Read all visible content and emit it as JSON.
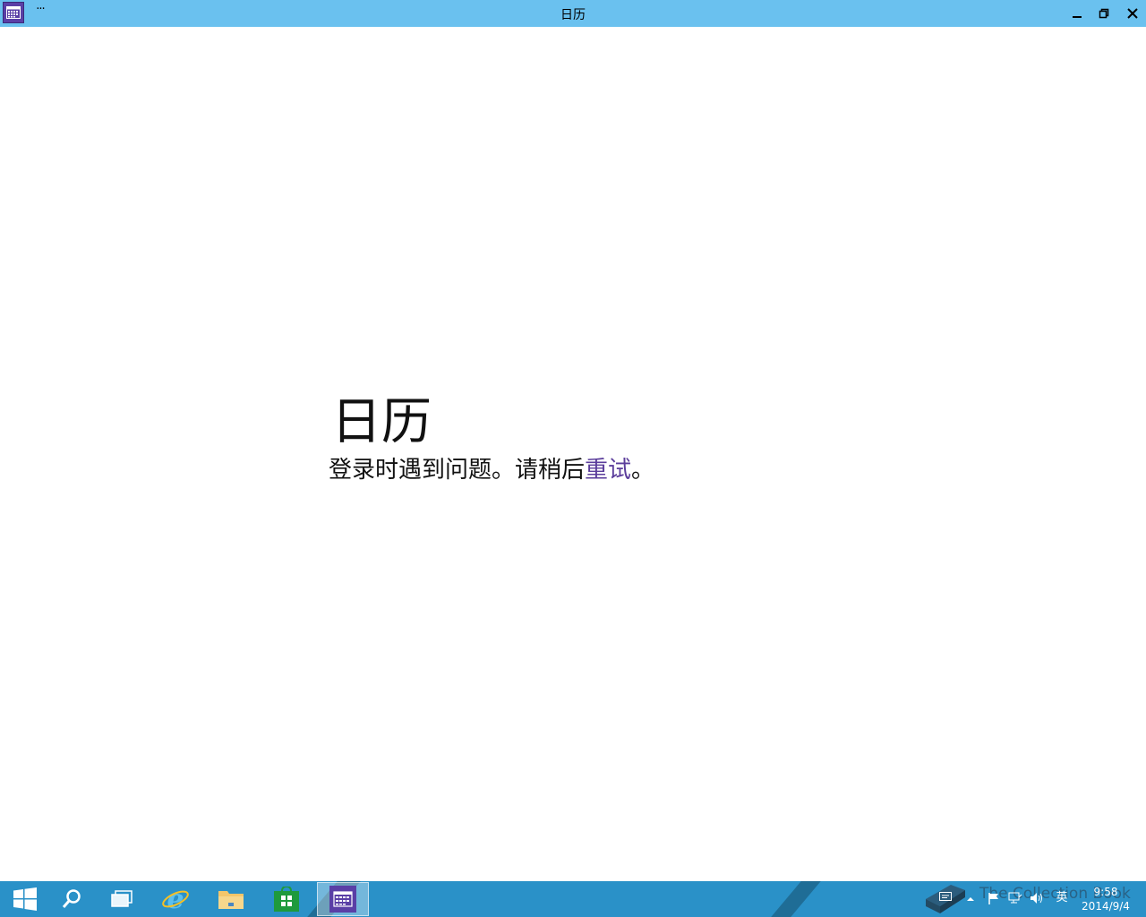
{
  "window": {
    "title": "日历",
    "more_label": "···"
  },
  "main": {
    "heading": "日历",
    "error_prefix": "登录时遇到问题。请稍后",
    "retry_link": "重试",
    "error_suffix": "。"
  },
  "taskbar": {
    "apps": [
      {
        "name": "start",
        "icon": "windows-logo-icon"
      },
      {
        "name": "search",
        "icon": "search-icon"
      },
      {
        "name": "task-view",
        "icon": "task-view-icon"
      },
      {
        "name": "internet-explorer",
        "icon": "ie-icon"
      },
      {
        "name": "file-explorer",
        "icon": "folder-icon"
      },
      {
        "name": "store",
        "icon": "store-icon"
      },
      {
        "name": "calendar",
        "icon": "calendar-icon",
        "active": true
      }
    ],
    "tray": {
      "ime_label": "英",
      "time": "9:58",
      "date": "2014/9/4"
    },
    "watermark": "The Collection Book"
  },
  "colors": {
    "titlebar": "#6ac1ef",
    "taskbar": "#2a91c8",
    "accent": "#5b3d9b"
  }
}
